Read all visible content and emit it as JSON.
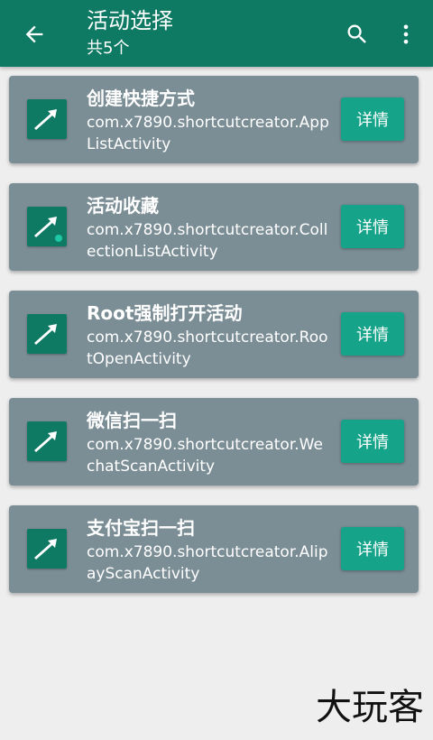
{
  "app_bar": {
    "title": "活动选择",
    "subtitle": "共5个",
    "color": "#0e7a63"
  },
  "icons": {
    "back": "arrow-left-icon",
    "search": "search-icon",
    "more": "more-vert-icon",
    "app": "shortcut-arrow-icon"
  },
  "activities": [
    {
      "title": "创建快捷方式",
      "subtitle": "com.x7890.shortcutcreator.AppListActivity",
      "button": "详情",
      "badge": false
    },
    {
      "title": "活动收藏",
      "subtitle": "com.x7890.shortcutcreator.CollectionListActivity",
      "button": "详情",
      "badge": true
    },
    {
      "title": "Root强制打开活动",
      "subtitle": "com.x7890.shortcutcreator.RootOpenActivity",
      "button": "详情",
      "badge": false
    },
    {
      "title": "微信扫一扫",
      "subtitle": "com.x7890.shortcutcreator.WechatScanActivity",
      "button": "详情",
      "badge": false
    },
    {
      "title": "支付宝扫一扫",
      "subtitle": "com.x7890.shortcutcreator.AlipayScanActivity",
      "button": "详情",
      "badge": false
    }
  ],
  "watermark": "大玩客",
  "colors": {
    "card": "#7b8d95",
    "button": "#15a38a",
    "background": "#eeeeee"
  }
}
